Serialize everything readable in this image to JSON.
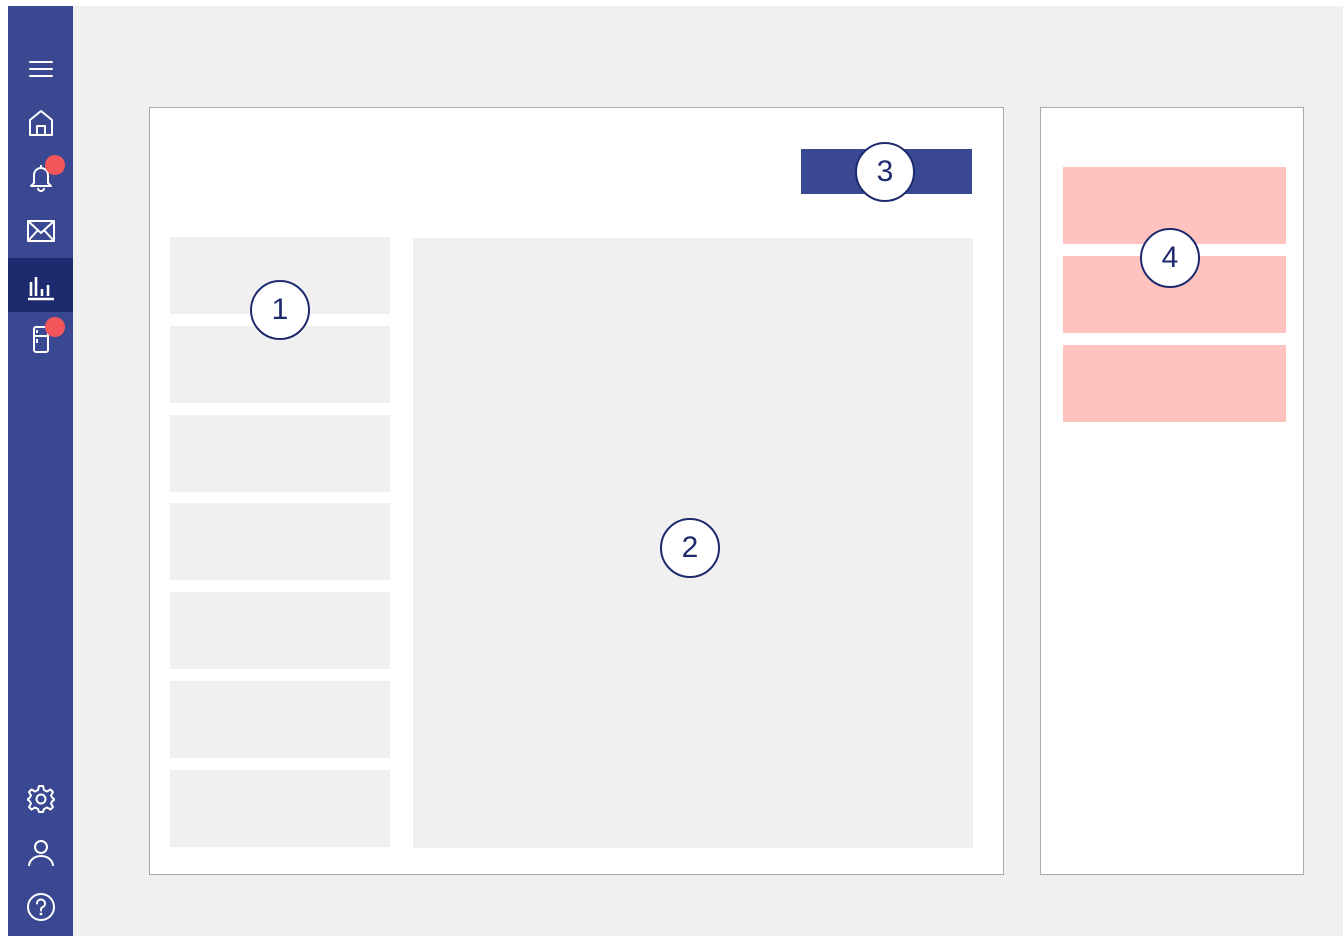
{
  "sidebar": {
    "items": [
      {
        "icon": "menu-icon"
      },
      {
        "icon": "home-icon"
      },
      {
        "icon": "bell-icon",
        "badge": true
      },
      {
        "icon": "mail-icon"
      },
      {
        "icon": "chart-icon",
        "active": true
      },
      {
        "icon": "fridge-icon",
        "badge": true
      }
    ],
    "bottom_items": [
      {
        "icon": "gear-icon"
      },
      {
        "icon": "user-icon"
      },
      {
        "icon": "help-icon"
      }
    ],
    "badge_color": "#f2555a"
  },
  "callouts": {
    "list": "1",
    "content": "2",
    "button": "3",
    "side_cards": "4"
  },
  "colors": {
    "sidebar": "#3a4891",
    "sidebar_active": "#1e2a6e",
    "background": "#f0f0f0",
    "placeholder": "#f0f0f0",
    "accent_button": "#3a4891",
    "side_card": "#ffc2bf",
    "callout_border": "#1e2a6e"
  }
}
